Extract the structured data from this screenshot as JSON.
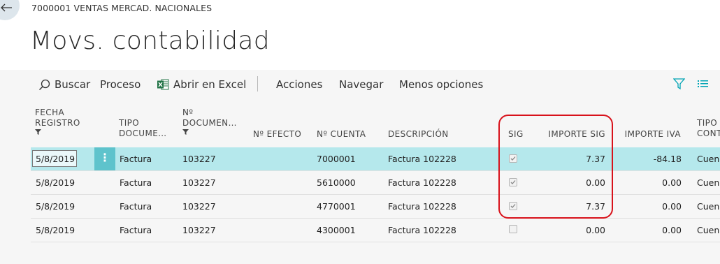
{
  "header": {
    "breadcrumb": "7000001 VENTAS MERCAD. NACIONALES",
    "title": "Movs. contabilidad"
  },
  "toolbar": {
    "search": "Buscar",
    "process": "Proceso",
    "excel": "Abrir en Excel",
    "actions": "Acciones",
    "navigate": "Navegar",
    "fewer_options": "Menos opciones"
  },
  "columns": {
    "fecha": [
      "FECHA",
      "REGISTRO"
    ],
    "tipo_doc": [
      "TIPO",
      "DOCUME…"
    ],
    "num_doc": [
      "Nº",
      "DOCUMEN…"
    ],
    "efecto": "Nº EFECTO",
    "cuenta": "Nº CUENTA",
    "descripcion": "DESCRIPCIÓN",
    "sig": "SIG",
    "importe_sig": "IMPORTE SIG",
    "importe_iva": "IMPORTE IVA",
    "tipo_cont": [
      "TIPO",
      "CONT"
    ]
  },
  "rows": [
    {
      "fecha": "5/8/2019",
      "tipo": "Factura",
      "documento": "103227",
      "cuenta": "7000001",
      "descripcion": "Factura 102228",
      "sig": true,
      "importe_sig": "7.37",
      "importe_iva": "-84.18",
      "tipo_cont": "Cuen"
    },
    {
      "fecha": "5/8/2019",
      "tipo": "Factura",
      "documento": "103227",
      "cuenta": "5610000",
      "descripcion": "Factura 102228",
      "sig": true,
      "importe_sig": "0.00",
      "importe_iva": "0.00",
      "tipo_cont": "Cuen"
    },
    {
      "fecha": "5/8/2019",
      "tipo": "Factura",
      "documento": "103227",
      "cuenta": "4770001",
      "descripcion": "Factura 102228",
      "sig": true,
      "importe_sig": "7.37",
      "importe_iva": "0.00",
      "tipo_cont": "Cuen"
    },
    {
      "fecha": "5/8/2019",
      "tipo": "Factura",
      "documento": "103227",
      "cuenta": "4300001",
      "descripcion": "Factura 102228",
      "sig": false,
      "importe_sig": "0.00",
      "importe_iva": "0.00",
      "tipo_cont": "Cuen"
    }
  ],
  "row_menu_glyph": "⋮",
  "colors": {
    "selected_row": "#b5e8ec",
    "row_menu": "#5ec3cc",
    "excel_green": "#217346",
    "accent": "#00a4b4",
    "highlight": "#d8121b"
  }
}
